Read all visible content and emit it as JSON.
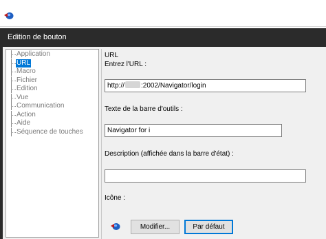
{
  "dialog": {
    "title": "Edition de bouton"
  },
  "tree": {
    "items": [
      {
        "label": "Application",
        "selected": false
      },
      {
        "label": "URL",
        "selected": true
      },
      {
        "label": "Macro",
        "selected": false
      },
      {
        "label": "Fichier",
        "selected": false
      },
      {
        "label": "Edition",
        "selected": false
      },
      {
        "label": "Vue",
        "selected": false
      },
      {
        "label": "Communication",
        "selected": false
      },
      {
        "label": "Action",
        "selected": false
      },
      {
        "label": "Aide",
        "selected": false
      },
      {
        "label": "Séquence de touches",
        "selected": false
      }
    ]
  },
  "form": {
    "section_title": "URL",
    "url_label": "Entrez l'URL :",
    "url_prefix": "http://",
    "url_suffix": ":2002/Navigator/login",
    "toolbar_text_label": "Texte de la barre d'outils :",
    "toolbar_text_value": "Navigator for i",
    "description_label": "Description (affichée dans la barre d'état) :",
    "description_value": "",
    "icon_label": "Icône :",
    "modify_button": "Modifier...",
    "default_button": "Par défaut"
  },
  "icons": {
    "top": "navigator-globe-icon",
    "preview": "navigator-globe-icon"
  }
}
